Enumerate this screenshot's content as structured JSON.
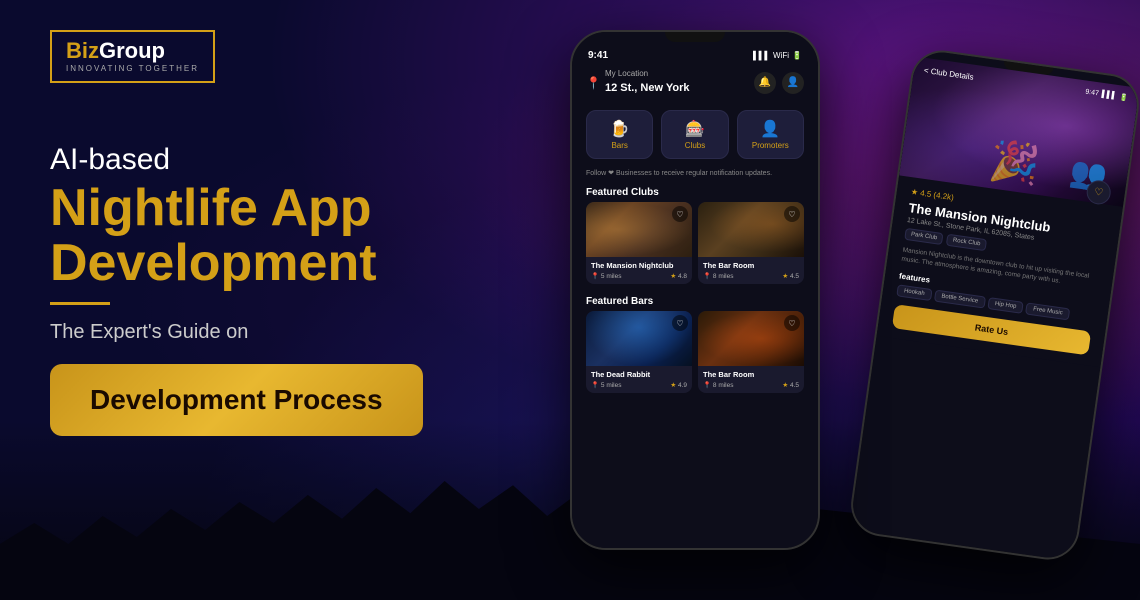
{
  "background": {
    "primary_color": "#0a0a2e",
    "accent_purple": "#1a0a3e"
  },
  "logo": {
    "brand_part1": "Biz",
    "brand_part2": "Group",
    "tagline": "INNOVATING TOGETHER"
  },
  "left_panel": {
    "prefix_text": "AI-based",
    "main_title_line1": "Nightlife App",
    "main_title_line2": "Development",
    "subtitle": "The Expert's Guide on",
    "cta_label": "Development Process"
  },
  "phone_main": {
    "status_time": "9:41",
    "status_signal": "▌▌▌",
    "status_wifi": "WiFi",
    "status_battery": "🔋",
    "location_label": "My Location",
    "location_value": "12 St., New York",
    "categories": [
      {
        "icon": "🍺",
        "label": "Bars"
      },
      {
        "icon": "🎰",
        "label": "Clubs"
      },
      {
        "icon": "👤",
        "label": "Promoters"
      }
    ],
    "follow_text": "Follow ❤ Businesses to receive regular notification updates.",
    "featured_clubs_title": "Featured Clubs",
    "featured_bars_title": "Featured Bars",
    "clubs": [
      {
        "name": "The Mansion Nightclub",
        "distance": "5 miles",
        "rating": "4.8"
      },
      {
        "name": "The Bar Room",
        "distance": "8 miles",
        "rating": "4.5"
      }
    ],
    "bars": [
      {
        "name": "The Dead Rabbit",
        "distance": "5 miles",
        "rating": "4.9"
      },
      {
        "name": "The Bar Room",
        "distance": "8 miles",
        "rating": "4.5"
      }
    ]
  },
  "phone_secondary": {
    "status_time": "9:47",
    "back_label": "< Club Details",
    "rating": "4.5 (4.2k)",
    "club_name": "The Mansion Nightclub",
    "address": "12 Lake St., Stone Park, IL 62085, States",
    "tags": [
      "Park Club",
      "Rock Club"
    ],
    "description": "Mansion Nightclub is the downtown club to hit up visiting the local music. The atmosphere is amazing, come party with us.",
    "features_title": "features",
    "features": [
      "Hookah",
      "Bottle Service",
      "Hip Hop",
      "Free Music"
    ],
    "rate_button": "Rate Us"
  }
}
